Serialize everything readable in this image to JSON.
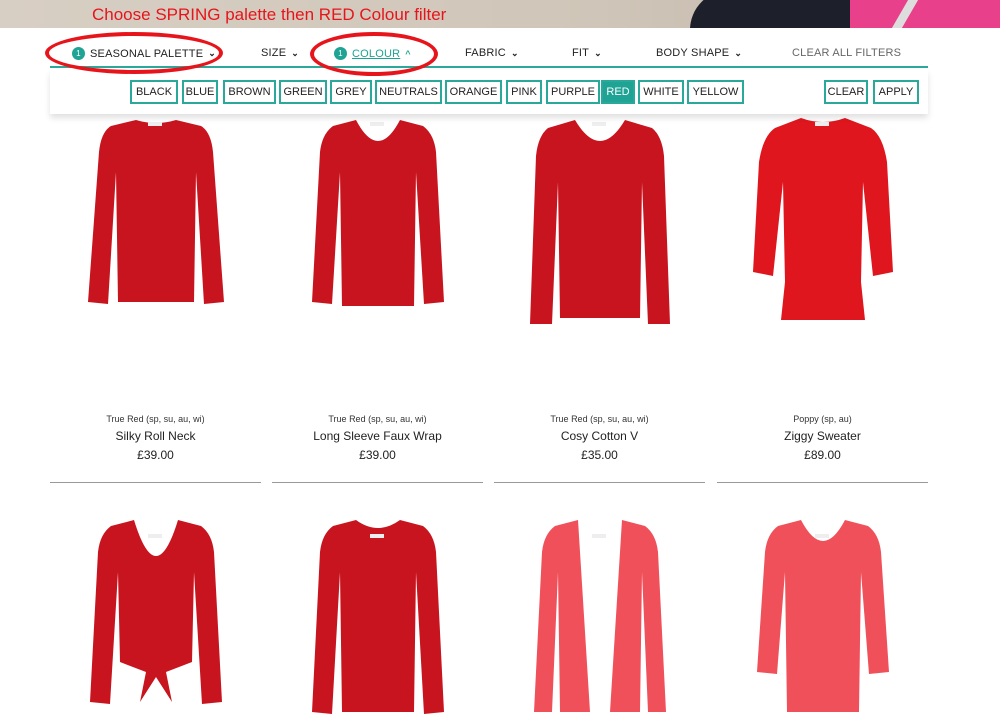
{
  "annotation": "Choose SPRING palette then RED Colour filter",
  "filters": [
    {
      "label": "SEASONAL PALETTE",
      "count": "1",
      "chevron": "chevron-down"
    },
    {
      "label": "SIZE",
      "chevron": "chevron-down"
    },
    {
      "label": "COLOUR",
      "count": "1",
      "chevron": "chevron-up",
      "active": true
    },
    {
      "label": "FABRIC",
      "chevron": "chevron-down"
    },
    {
      "label": "FIT",
      "chevron": "chevron-down"
    },
    {
      "label": "BODY SHAPE",
      "chevron": "chevron-down"
    }
  ],
  "clear_all": "CLEAR ALL FILTERS",
  "colours": [
    "BLACK",
    "BLUE",
    "BROWN",
    "GREEN",
    "GREY",
    "NEUTRALS",
    "ORANGE",
    "PINK",
    "PURPLE",
    "RED",
    "WHITE",
    "YELLOW"
  ],
  "selected_colour": "RED",
  "clear": "CLEAR",
  "apply": "APPLY",
  "accent": "#1ea394",
  "products": [
    {
      "shade": "True Red (sp, su, au, wi)",
      "name": "Silky Roll Neck",
      "price": "£39.00",
      "color": "#c8141e"
    },
    {
      "shade": "True Red (sp, su, au, wi)",
      "name": "Long Sleeve Faux Wrap",
      "price": "£39.00",
      "color": "#c8141e"
    },
    {
      "shade": "True Red (sp, su, au, wi)",
      "name": "Cosy Cotton V",
      "price": "£35.00",
      "color": "#c8141e"
    },
    {
      "shade": "Poppy (sp, au)",
      "name": "Ziggy Sweater",
      "price": "£89.00",
      "color": "#e0161e"
    },
    {
      "color": "#c8141e"
    },
    {
      "color": "#c8141e"
    },
    {
      "color": "#f0505a"
    },
    {
      "color": "#f0505a"
    }
  ]
}
